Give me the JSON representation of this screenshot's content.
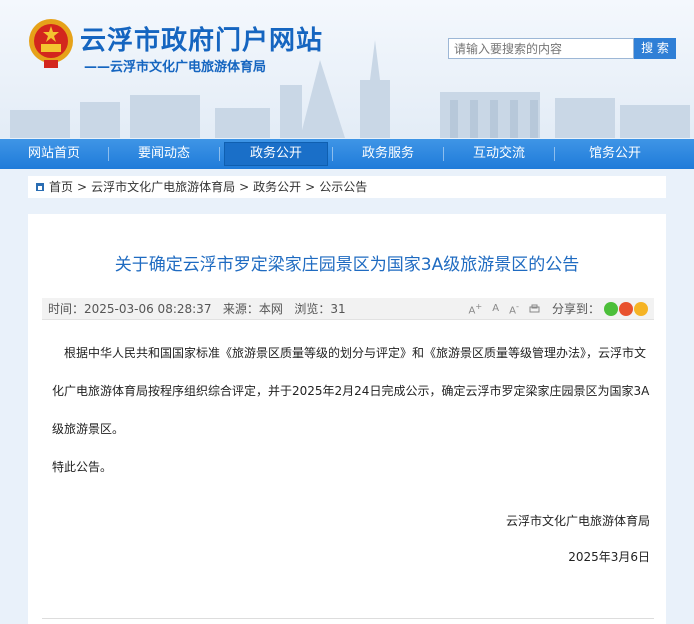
{
  "header": {
    "site_title": "云浮市政府门户网站",
    "site_subtitle": "——云浮市文化广电旅游体育局",
    "search_placeholder": "请输入要搜索的内容",
    "search_button": "搜 索"
  },
  "nav": {
    "items": [
      {
        "label": "网站首页"
      },
      {
        "label": "要闻动态"
      },
      {
        "label": "政务公开",
        "active": true
      },
      {
        "label": "政务服务"
      },
      {
        "label": "互动交流"
      },
      {
        "label": "馆务公开"
      }
    ]
  },
  "breadcrumb": {
    "items": [
      "首页",
      "云浮市文化广电旅游体育局",
      "政务公开",
      "公示公告"
    ],
    "separator": ">"
  },
  "article": {
    "title": "关于确定云浮市罗定梁家庄园景区为国家3A级旅游景区的公告",
    "meta_time": "时间：2025-03-06 08:28:37",
    "meta_source": "来源：本网",
    "meta_views": "浏览：31",
    "share_label": "分享到：",
    "paragraph1": "根据中华人民共和国国家标准《旅游景区质量等级的划分与评定》和《旅游景区质量等级管理办法》，云浮市文化广电旅游体育局按程序组织综合评定，并于2025年2月24日完成公示，确定云浮市罗定梁家庄园景区为国家3A级旅游景区。",
    "paragraph2": "特此公告。",
    "signature": "云浮市文化广电旅游体育局",
    "date": "2025年3月6日"
  },
  "icons": {
    "font_larger": "font-larger-icon",
    "font_normal": "font-normal-icon",
    "font_smaller": "font-smaller-icon",
    "print": "print-icon",
    "wechat": "wechat-icon",
    "weibo": "weibo-icon",
    "qzone": "qzone-icon"
  },
  "colors": {
    "brand_blue": "#1565c0",
    "nav_blue": "#2a86df",
    "title_blue": "#1f6bc1",
    "wechat_green": "#4cbf3a",
    "weibo_red": "#e8512d",
    "qzone_yellow": "#f5b324"
  }
}
